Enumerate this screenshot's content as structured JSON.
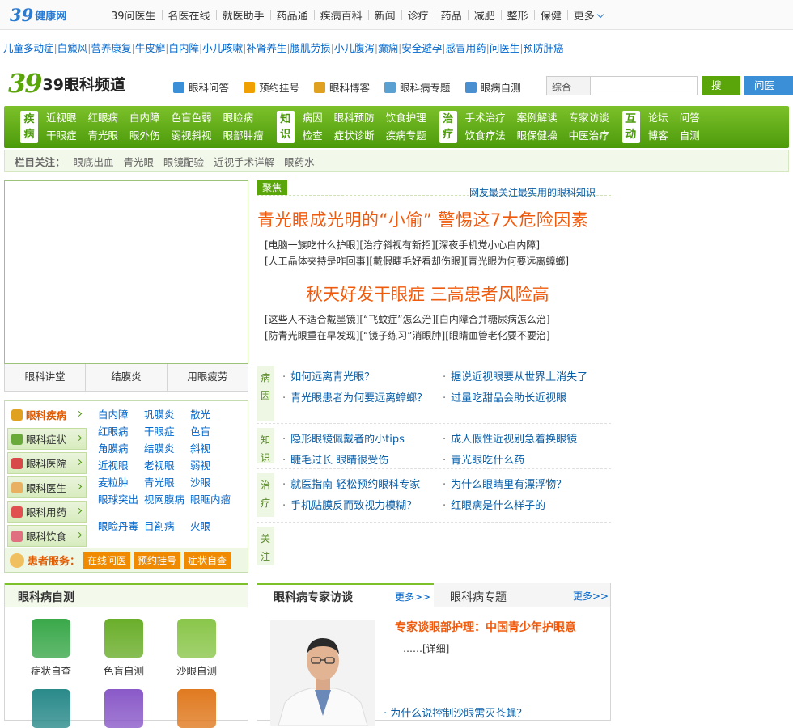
{
  "site": {
    "logo_number": "39",
    "logo_text": "健康网"
  },
  "top_nav": [
    "39问医生",
    "名医在线",
    "就医助手",
    "药品通",
    "疾病百科",
    "新闻",
    "诊疗",
    "药品",
    "减肥",
    "整形",
    "保健",
    "更多"
  ],
  "hot_links": [
    "儿童多动症",
    "白癜风",
    "营养康复",
    "牛皮癣",
    "白内障",
    "小儿咳嗽",
    "补肾养生",
    "腰肌劳损",
    "小儿腹泻",
    "癫痫",
    "安全避孕",
    "感冒用药",
    "问医生",
    "预防肝癌"
  ],
  "channel": {
    "logo_number": "39",
    "logo_text": "39眼科频道"
  },
  "quick_nav": [
    {
      "label": "眼科问答",
      "icon": "question-person-icon",
      "color": "#3a8fd6"
    },
    {
      "label": "预约挂号",
      "icon": "appointment-icon",
      "color": "#f0a000"
    },
    {
      "label": "眼科博客",
      "icon": "blog-person-icon",
      "color": "#e0a020"
    },
    {
      "label": "眼科病专题",
      "icon": "topic-icon",
      "color": "#5aa0d0"
    },
    {
      "label": "眼病自测",
      "icon": "chart-icon",
      "color": "#4a90d0"
    }
  ],
  "search": {
    "category": "综合",
    "placeholder": "",
    "search_button": "搜索",
    "ask_button": "问医生"
  },
  "main_nav": [
    {
      "badge": "疾病",
      "links": [
        "近视眼",
        "干眼症",
        "红眼病",
        "青光眼",
        "白内障",
        "眼外伤",
        "色盲色弱",
        "弱视斜视",
        "眼睑病",
        "眼部肿瘤"
      ]
    },
    {
      "badge": "知识",
      "links": [
        "病因",
        "检查",
        "眼科预防",
        "症状诊断",
        "饮食护理",
        "疾病专题"
      ]
    },
    {
      "badge": "治疗",
      "links": [
        "手术治疗",
        "饮食疗法",
        "案例解读",
        "眼保健操",
        "专家访谈",
        "中医治疗"
      ]
    },
    {
      "badge": "互动",
      "links": [
        "论坛",
        "博客",
        "问答",
        "自测"
      ]
    }
  ],
  "sub_bar": {
    "label": "栏目关注：",
    "links": [
      "眼底出血",
      "青光眼",
      "眼镜配验",
      "近视手术详解",
      "眼药水"
    ]
  },
  "image_tabs": [
    "眼科讲堂",
    "结膜炎",
    "用眼疲劳"
  ],
  "categories": {
    "items": [
      {
        "label": "眼科疾病",
        "active": true,
        "icon_color": "#e0a020"
      },
      {
        "label": "眼科症状",
        "active": false,
        "icon_color": "#6aaa3a"
      },
      {
        "label": "眼科医院",
        "active": false,
        "icon_color": "#d84a4a"
      },
      {
        "label": "眼科医生",
        "active": false,
        "icon_color": "#e8b060"
      },
      {
        "label": "眼科用药",
        "active": false,
        "icon_color": "#e05050"
      },
      {
        "label": "眼科饮食",
        "active": false,
        "icon_color": "#e07080"
      }
    ],
    "diseases": [
      "白内障",
      "巩膜炎",
      "散光",
      "红眼病",
      "干眼症",
      "色盲",
      "角膜病",
      "结膜炎",
      "斜视",
      "近视眼",
      "老视眼",
      "弱视",
      "麦粒肿",
      "青光眼",
      "沙眼",
      "眼球突出",
      "视网膜病",
      "眼眶内瘤"
    ],
    "diseases2": [
      "眼睑丹毒",
      "目劄病",
      "火眼"
    ]
  },
  "service": {
    "label": "患者服务：",
    "buttons": [
      "在线问医",
      "预约挂号",
      "症状自查"
    ]
  },
  "self_test": {
    "title": "眼科病自测",
    "items": [
      {
        "label": "症状自查",
        "icon": "medical-cross-icon",
        "color": "#3aa84a"
      },
      {
        "label": "色盲自测",
        "icon": "people-icon",
        "color": "#6aae2a"
      },
      {
        "label": "沙眼自测",
        "icon": "device-icon",
        "color": "#8ac64a"
      },
      {
        "label": "",
        "icon": "body-icon",
        "color": "#2a8a8a"
      },
      {
        "label": "",
        "icon": "tape-icon",
        "color": "#8a5ac8"
      },
      {
        "label": "",
        "icon": "calculator-icon",
        "color": "#e07a20"
      }
    ]
  },
  "focus": {
    "tag": "聚焦",
    "note": "网友最关注最实用的眼科知识",
    "headline1": "青光眼成光明的“小偷” 警惕这7大危险因素",
    "links1": [
      [
        "[电脑一族吃什么护眼]",
        "[治疗斜视有新招]",
        "[深夜手机党小心白内障]"
      ],
      [
        "[人工晶体夹持是咋回事]",
        "[戴假睫毛好看却伤眼]",
        "[青光眼为何要远离蟑螂]"
      ]
    ],
    "headline2": "秋天好发干眼症 三高患者风险高",
    "links2": [
      [
        "[这些人不适合戴墨镜]",
        "[“飞蚊症”怎么治]",
        "[白内障合并糖尿病怎么治]"
      ],
      [
        "[防青光眼重在早发现]",
        "[“镜子练习”消眼肿]",
        "[眼睛血管老化要不要治]"
      ]
    ]
  },
  "qa_sections": [
    {
      "label": "病因",
      "items": [
        [
          "如何远离青光眼？",
          "据说近视眼要从世界上消失了"
        ],
        [
          "青光眼患者为何要远离蟑螂？",
          "过量吃甜品会助长近视眼"
        ]
      ]
    },
    {
      "label": "知识",
      "items": [
        [
          "隐形眼镜佩戴者的小tips",
          "成人假性近视别急着换眼镜"
        ],
        [
          "睫毛过长 眼睛很受伤",
          "青光眼吃什么药"
        ]
      ]
    },
    {
      "label": "治疗",
      "items": [
        [
          "就医指南 轻松预约眼科专家",
          "为什么眼睛里有漂浮物？"
        ],
        [
          "手机贴膜反而致视力模糊？",
          "红眼病是什么样子的"
        ]
      ]
    },
    {
      "label": "关注",
      "items": []
    }
  ],
  "expert": {
    "tab1": "眼科病专家访谈",
    "more1": "更多>>",
    "tab2": "眼科病专题",
    "more2": "更多>>",
    "title": "专家谈眼部护理：中国青少年护眼意",
    "detail": "……[详细]",
    "link": "为什么说控制沙眼需灭苍蝇？"
  }
}
